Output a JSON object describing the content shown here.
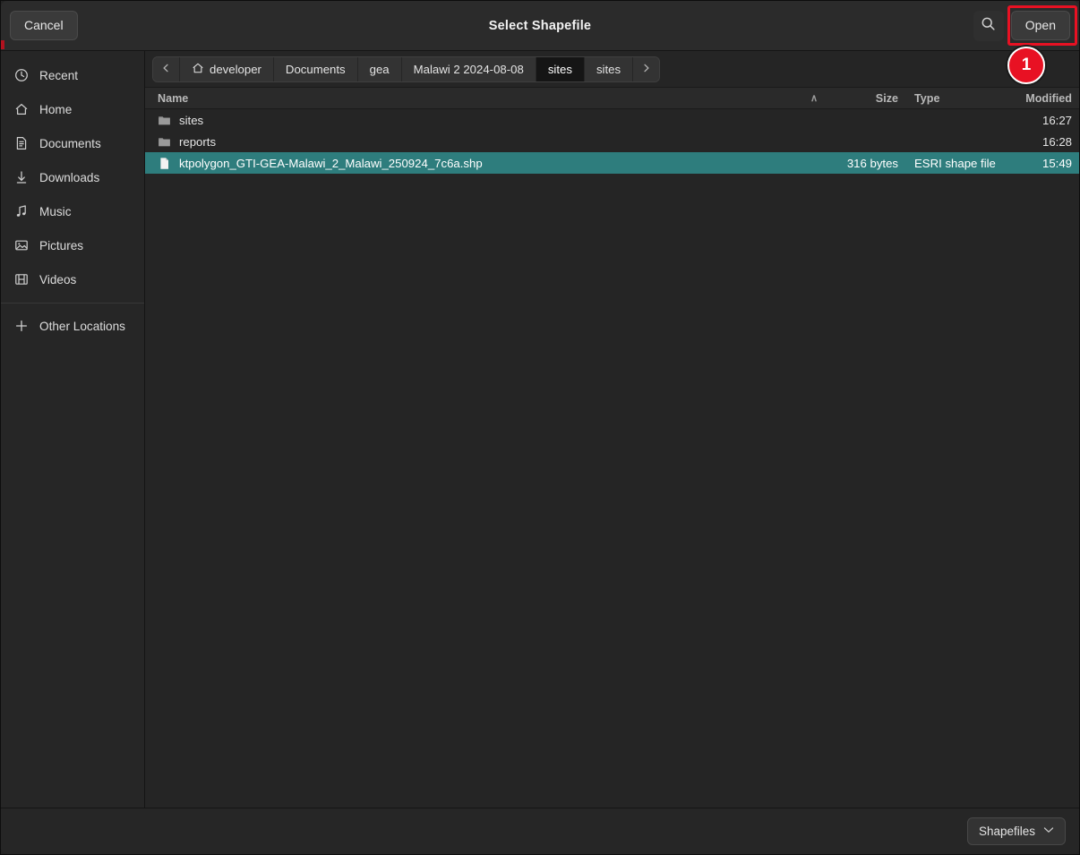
{
  "window": {
    "title": "Select Shapefile"
  },
  "header": {
    "cancel_label": "Cancel",
    "open_label": "Open",
    "search_icon": "search-icon"
  },
  "annotation": {
    "badge_number": "1",
    "color": "#e81123",
    "target": "open-button"
  },
  "sidebar": {
    "items": [
      {
        "label": "Recent",
        "icon": "clock-icon"
      },
      {
        "label": "Home",
        "icon": "home-icon"
      },
      {
        "label": "Documents",
        "icon": "document-icon"
      },
      {
        "label": "Downloads",
        "icon": "download-icon"
      },
      {
        "label": "Music",
        "icon": "music-note-icon"
      },
      {
        "label": "Pictures",
        "icon": "image-icon"
      },
      {
        "label": "Videos",
        "icon": "film-icon"
      }
    ],
    "other_locations": {
      "label": "Other Locations",
      "icon": "plus-icon"
    }
  },
  "pathbar": {
    "back_icon": "chevron-left-icon",
    "forward_icon": "chevron-right-icon",
    "crumbs": [
      {
        "label": "developer",
        "icon": "home-icon",
        "active": false
      },
      {
        "label": "Documents",
        "icon": "",
        "active": false
      },
      {
        "label": "gea",
        "icon": "",
        "active": false
      },
      {
        "label": "Malawi 2 2024-08-08",
        "icon": "",
        "active": false
      },
      {
        "label": "sites",
        "icon": "",
        "active": true
      },
      {
        "label": "sites",
        "icon": "",
        "active": false
      }
    ]
  },
  "columns": {
    "name": "Name",
    "size": "Size",
    "type": "Type",
    "modified": "Modified",
    "sort_indicator": "∧"
  },
  "files": [
    {
      "name": "sites",
      "icon": "folder-icon",
      "size": "",
      "type": "",
      "modified": "16:27",
      "selected": false
    },
    {
      "name": "reports",
      "icon": "folder-icon",
      "size": "",
      "type": "",
      "modified": "16:28",
      "selected": false
    },
    {
      "name": "ktpolygon_GTI-GEA-Malawi_2_Malawi_250924_7c6a.shp",
      "icon": "file-icon",
      "size": "316 bytes",
      "type": "ESRI shape file",
      "modified": "15:49",
      "selected": true
    }
  ],
  "footer": {
    "filter_label": "Shapefiles",
    "filter_icon": "chevron-down-icon"
  },
  "colors": {
    "selection": "#2e7d7d",
    "accent_red": "#e81123",
    "background": "#252525",
    "header": "#2b2b2b"
  }
}
